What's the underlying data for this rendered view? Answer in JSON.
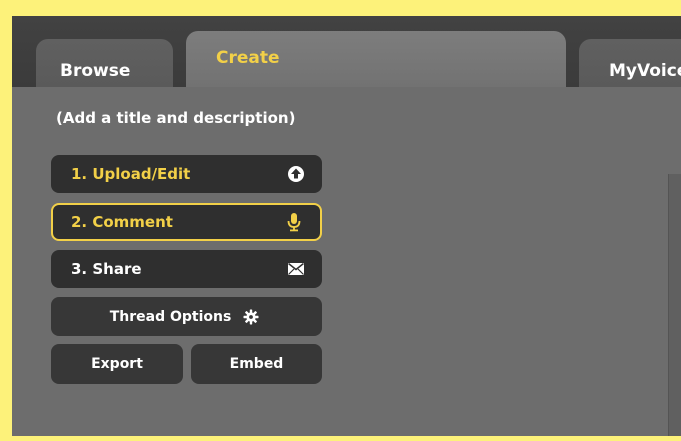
{
  "tabs": [
    {
      "label": "Browse"
    },
    {
      "label": "Create"
    },
    {
      "label": "MyVoice"
    }
  ],
  "hint": "(Add a title and description)",
  "steps": {
    "upload": {
      "label": "1. Upload/Edit",
      "icon": "upload-arrow-icon"
    },
    "comment": {
      "label": "2. Comment",
      "icon": "microphone-icon"
    },
    "share": {
      "label": "3. Share",
      "icon": "envelope-icon"
    }
  },
  "thread_options": {
    "label": "Thread Options",
    "icon": "gear-icon"
  },
  "export_label": "Export",
  "embed_label": "Embed",
  "colors": {
    "accent": "#f2d048",
    "background": "#fdf27a",
    "panel": "#6d6d6d",
    "button": "#2f2f2f"
  }
}
